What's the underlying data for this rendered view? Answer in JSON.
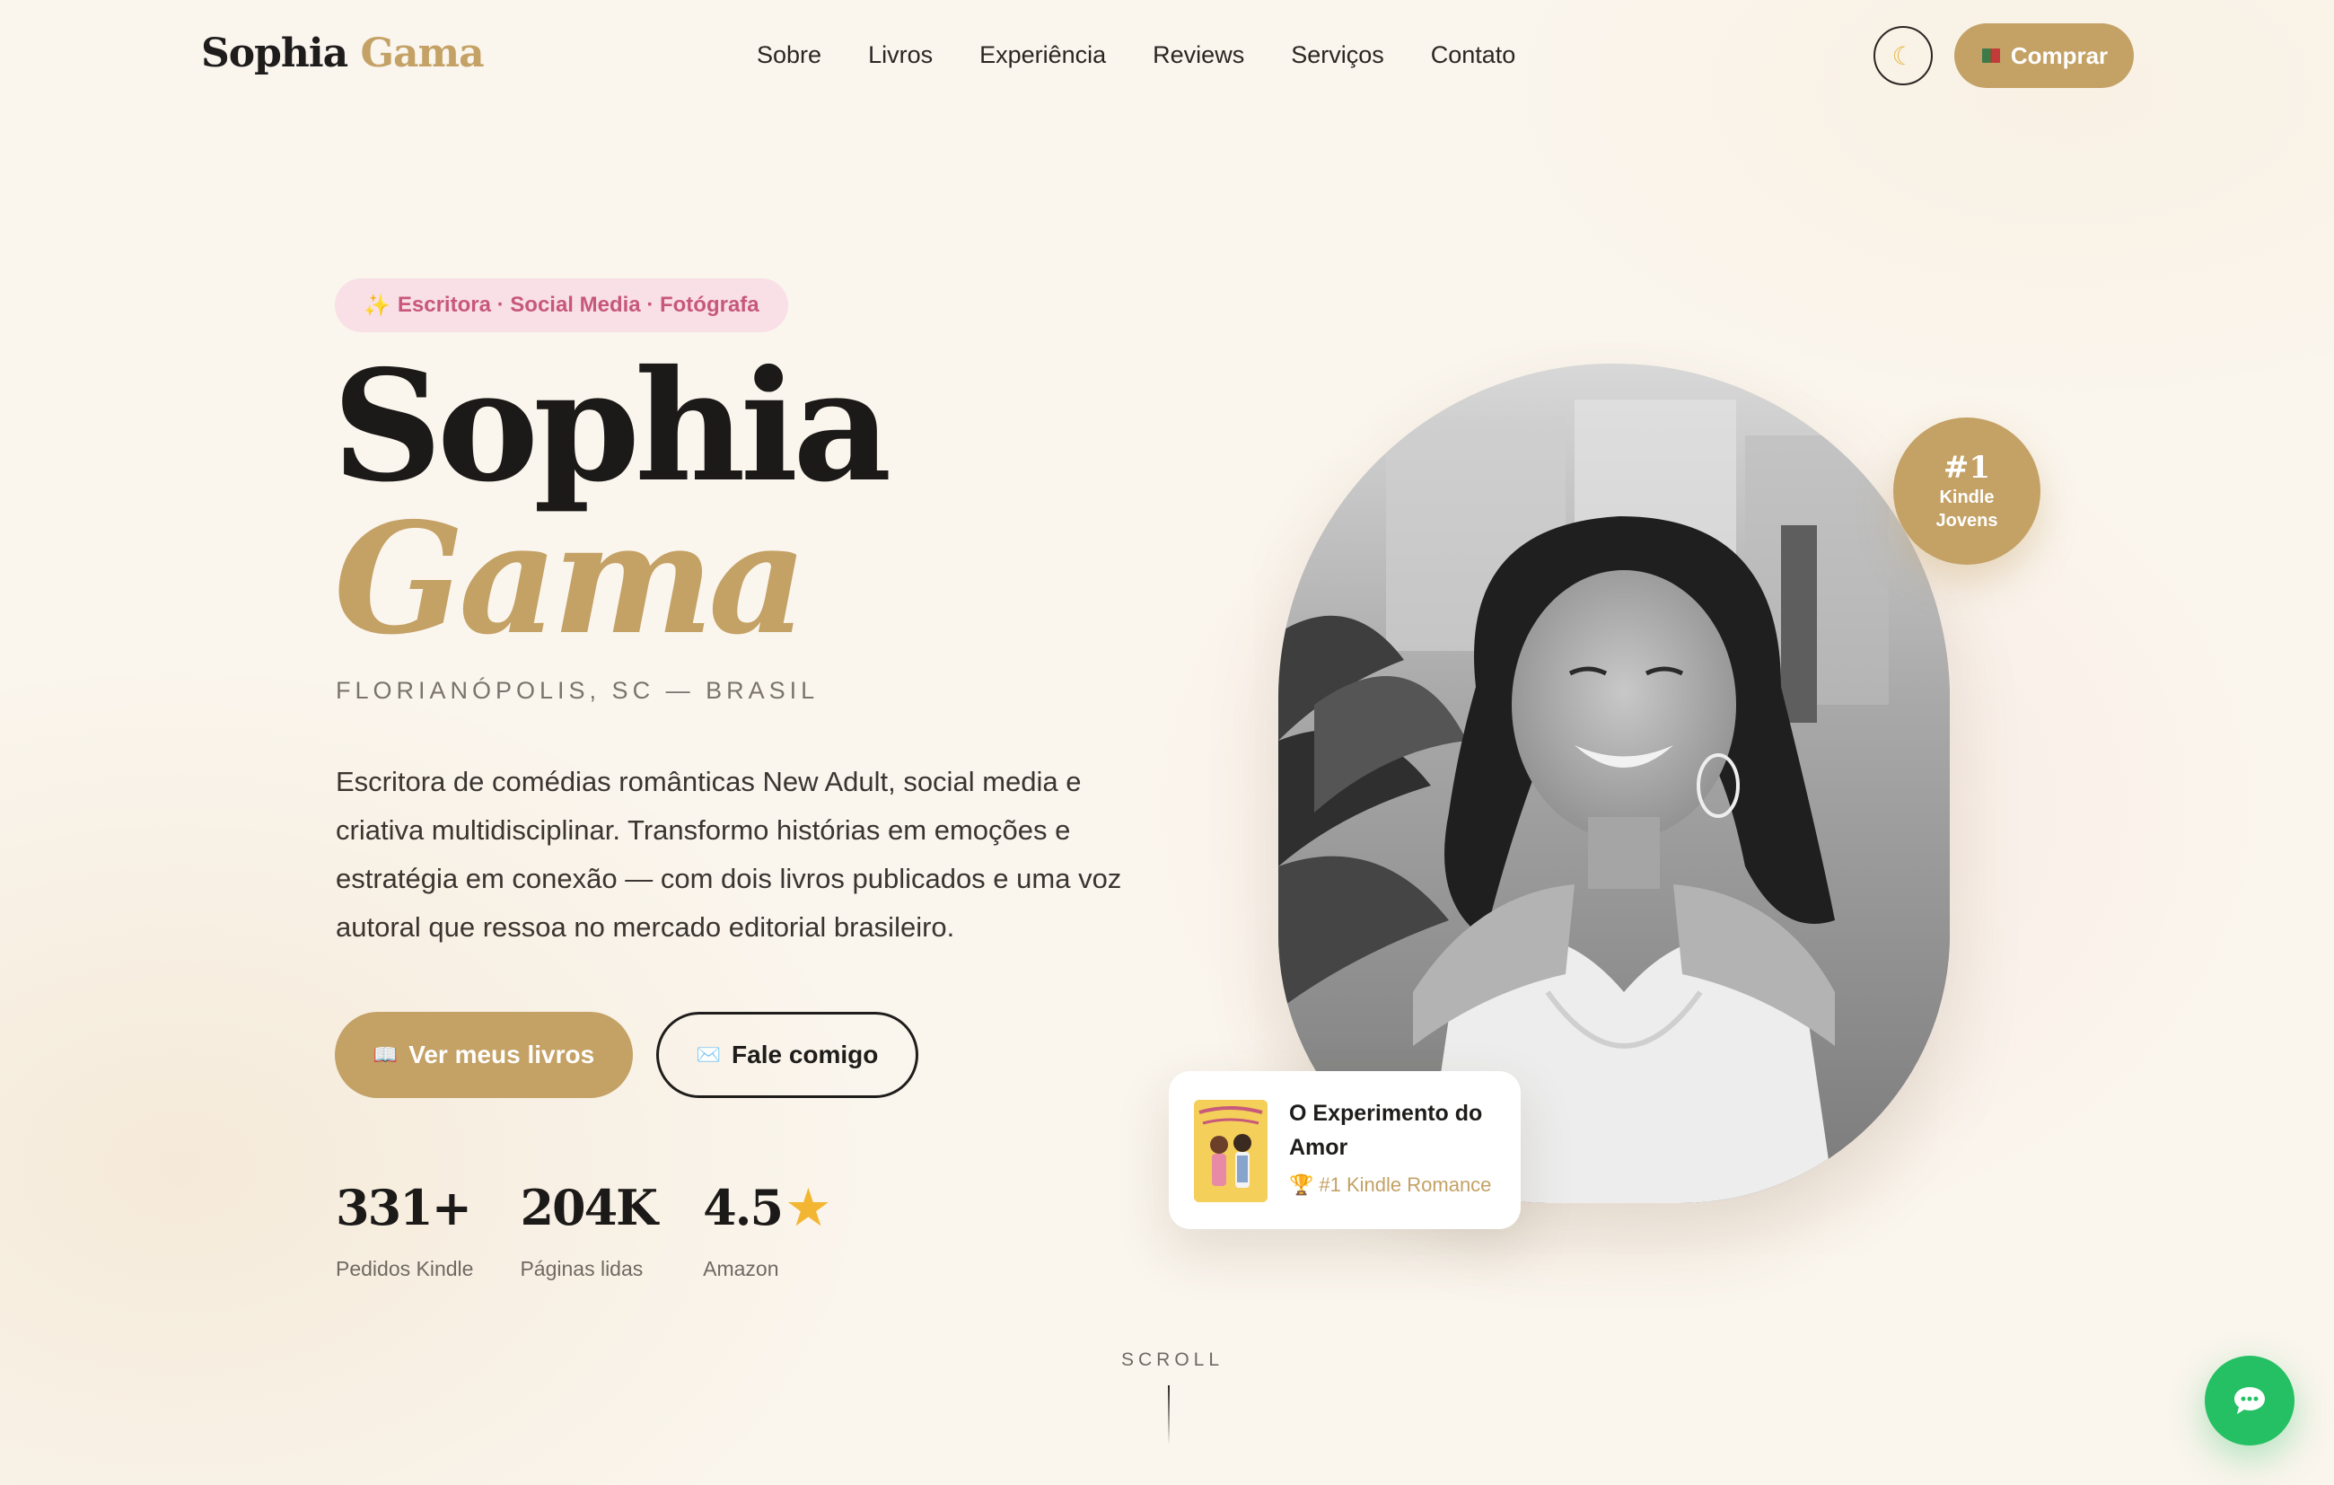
{
  "nav": {
    "brand_first": "Sophia",
    "brand_last": "Gama",
    "links": [
      "Sobre",
      "Livros",
      "Experiência",
      "Reviews",
      "Serviços",
      "Contato"
    ],
    "theme_toggle_icon": "moon-icon",
    "theme_toggle_glyph": "☾",
    "buy_icon": "book-icon",
    "buy_label": "Comprar"
  },
  "hero": {
    "tag": "Escritora · Social Media · Fotógrafa",
    "tag_icon": "sparkles-icon",
    "name_first": "Sophia",
    "name_last": "Gama",
    "location": "FLORIANÓPOLIS, SC — BRASIL",
    "bio": "Escritora de comédias românticas New Adult, social media e criativa multidisciplinar. Transformo histórias em emoções e estratégia em conexão — com dois livros publicados e uma voz autoral que ressoa no mercado editorial brasileiro.",
    "primary_cta": "Ver meus livros",
    "primary_cta_icon": "open-book-icon",
    "secondary_cta": "Fale comigo",
    "secondary_cta_icon": "envelope-icon",
    "stats": [
      {
        "value": "331+",
        "label": "Pedidos Kindle"
      },
      {
        "value": "204K",
        "label": "Páginas lidas"
      },
      {
        "value": "4.5",
        "label": "Amazon",
        "icon": "star-icon"
      }
    ]
  },
  "portrait": {
    "badge_rank": "#1",
    "badge_line1": "Kindle",
    "badge_line2": "Jovens"
  },
  "featured_book": {
    "title": "O Experimento do Amor",
    "award": "#1 Kindle Romance",
    "award_icon": "trophy-icon"
  },
  "scroll_label": "SCROLL",
  "chat": {
    "icon": "chat-bubble-icon"
  },
  "colors": {
    "background": "#faf5ed",
    "accent_gold": "#c4a165",
    "tag_pink_bg": "#f9e0e6",
    "tag_pink_text": "#c7587a",
    "chat_green": "#25c064"
  }
}
